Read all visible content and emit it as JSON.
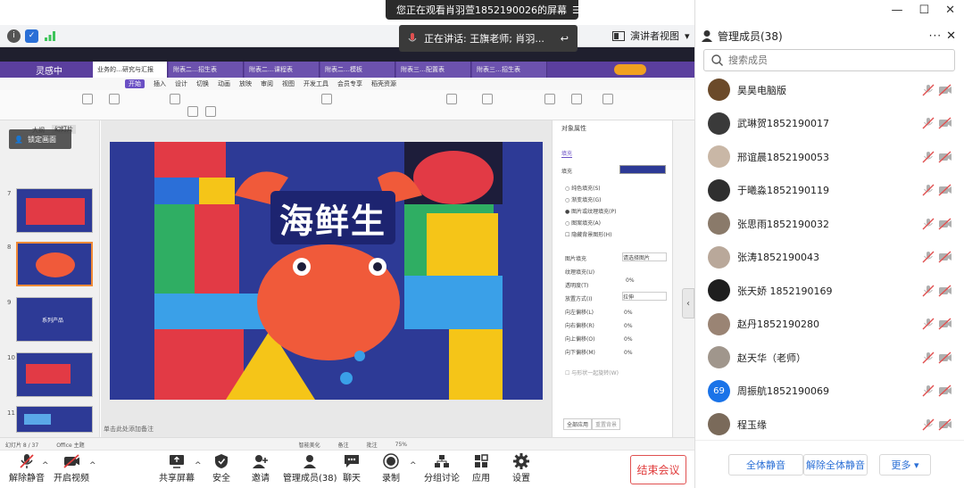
{
  "share_banner": {
    "text": "您正在观看肖羽萱1852190026的屏幕",
    "menu_icon": "menu-lines-icon"
  },
  "speaking": {
    "text": "正在讲话: 王旗老师; 肖羽..."
  },
  "presenter": {
    "label": "演讲者视图"
  },
  "status_icons": [
    "info-icon",
    "shield-icon",
    "signal-bars-icon"
  ],
  "ppt": {
    "brand": "灵感中",
    "tabs": [
      "业务的…研究与汇报",
      "附表二…招生表",
      "附表二…课程表",
      "附表二…模板",
      "附表三…配置表",
      "附表三…招生表"
    ],
    "menu": [
      "开始",
      "插入",
      "设计",
      "切换",
      "动画",
      "放映",
      "审阅",
      "视图",
      "开发工具",
      "会员专享",
      "稻壳资源"
    ],
    "lock_screen": "锁定画面",
    "thumb_numbers": [
      "7",
      "8",
      "9",
      "10",
      "11"
    ],
    "thumb_tabs": [
      "大纲",
      "幻灯片"
    ],
    "slide_title": "海鲜生",
    "thumb_labels": [
      "系列产品"
    ],
    "notes_hint": "单击此处添加备注",
    "status": [
      "幻灯片 8 / 37",
      "Office 主题",
      "智能美化",
      "备注",
      "批注",
      "75%"
    ],
    "object_panel": {
      "title": "对象属性",
      "tab": "填充",
      "section": "填充",
      "options": [
        "纯色填充(S)",
        "渐变填充(G)",
        "图片或纹理填充(P)",
        "图案填充(A)",
        "隐藏背景图形(H)"
      ],
      "fields": [
        "图片填充",
        "纹理填充(U)",
        "透明度(T)",
        "放置方式(I)",
        "向左偏移(L)",
        "向右偏移(R)",
        "向上偏移(O)",
        "向下偏移(M)"
      ],
      "select_value": "请选择图片",
      "opacity": "0%",
      "placement": "拉伸",
      "offset_value": "0%",
      "footer_buttons": [
        "全部应用",
        "重置背景"
      ],
      "checkbox": "与形状一起旋转(W)"
    }
  },
  "toolbar": {
    "unmute": "解除静音",
    "start_video": "开启视频",
    "share_screen": "共享屏幕",
    "security": "安全",
    "invite": "邀请",
    "manage_members": "管理成员(38)",
    "chat": "聊天",
    "record": "录制",
    "breakout": "分组讨论",
    "apps": "应用",
    "settings": "设置",
    "end_meeting": "结束会议"
  },
  "panel": {
    "title": "管理成员(38)",
    "search_placeholder": "搜索成员",
    "members": [
      {
        "name": "昊昊电脑版",
        "avatar_color": "#6b4a2a"
      },
      {
        "name": "武琳贺1852190017",
        "avatar_color": "#3a3a3a"
      },
      {
        "name": "邢谊晨1852190053",
        "avatar_color": "#c9b7a6"
      },
      {
        "name": "于曦淼1852190119",
        "avatar_color": "#2f2f2f"
      },
      {
        "name": "张思雨1852190032",
        "avatar_color": "#8a7a6a"
      },
      {
        "name": "张涛1852190043",
        "avatar_color": "#b9a89a"
      },
      {
        "name": "张天娇 1852190169",
        "avatar_color": "#1e1e1e"
      },
      {
        "name": "赵丹1852190280",
        "avatar_color": "#9a8474"
      },
      {
        "name": "赵天华（老师）",
        "avatar_color": "#a0968c"
      },
      {
        "name": "周振航1852190069",
        "avatar_color": "#1a73e8",
        "avatar_text": "69"
      },
      {
        "name": "程玉缘",
        "avatar_color": "#7a6a5a"
      }
    ],
    "buttons": [
      "全体静音",
      "解除全体静音",
      "更多"
    ]
  },
  "colors": {
    "accent_red": "#e03a3a",
    "accent_blue": "#2a6fd6",
    "slide_bg": "#2d3a96",
    "ppt_purple": "#5b3f9e"
  }
}
